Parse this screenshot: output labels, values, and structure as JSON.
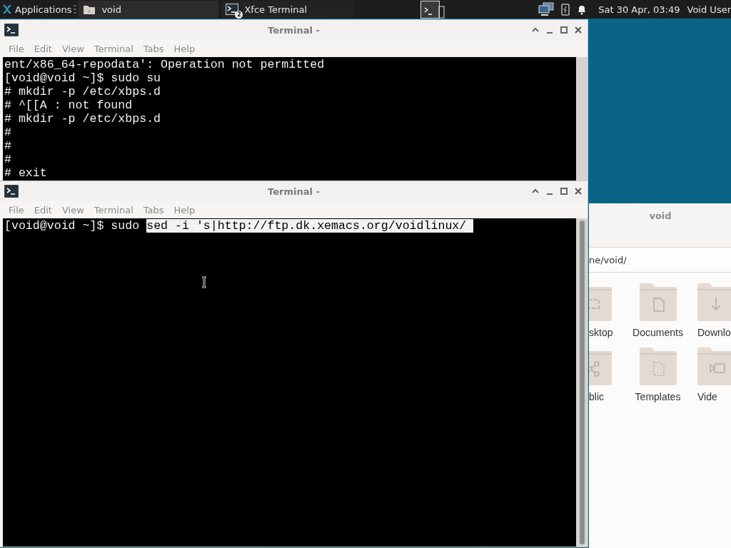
{
  "panel": {
    "apps_menu": "Applications",
    "tasks": [
      {
        "label": "void",
        "kind": "folder"
      },
      {
        "label": "Xfce Terminal",
        "kind": "terminal",
        "badge": "2"
      }
    ],
    "clock": "Sat 30 Apr, 03:49",
    "user": "Void User"
  },
  "file_manager": {
    "title": "void",
    "path": "ne/void/",
    "items": [
      {
        "label": "sktop",
        "kind": "desktop"
      },
      {
        "label": "Documents",
        "kind": "documents"
      },
      {
        "label": "Downlo",
        "kind": "downloads"
      },
      {
        "label": "blic",
        "kind": "public"
      },
      {
        "label": "Templates",
        "kind": "templates"
      },
      {
        "label": "Vide",
        "kind": "videos"
      }
    ]
  },
  "terminals": [
    {
      "title": "Terminal -",
      "menu": [
        "File",
        "Edit",
        "View",
        "Terminal",
        "Tabs",
        "Help"
      ],
      "lines": [
        [
          {
            "text": "ent/x86_64-repodata': Operation not permitted",
            "selected": false
          }
        ],
        [
          {
            "text": "[void@void ~]$ sudo su",
            "selected": false
          }
        ],
        [
          {
            "text": "# mkdir -p /etc/xbps.d",
            "selected": false
          }
        ],
        [
          {
            "text": "# ^[[A : not found",
            "selected": false
          }
        ],
        [
          {
            "text": "# mkdir -p /etc/xbps.d",
            "selected": false
          }
        ],
        [
          {
            "text": "#",
            "selected": false
          }
        ],
        [
          {
            "text": "#",
            "selected": false
          }
        ],
        [
          {
            "text": "#",
            "selected": false
          }
        ],
        [
          {
            "text": "# exit",
            "selected": false
          }
        ]
      ]
    },
    {
      "title": "Terminal -",
      "menu": [
        "File",
        "Edit",
        "View",
        "Terminal",
        "Tabs",
        "Help"
      ],
      "lines": [
        [
          {
            "text": "[void@void ~]$ sudo ",
            "selected": false
          },
          {
            "text": "sed -i 's|http://ftp.dk.xemacs.org/voidlinux/ ",
            "selected": true
          }
        ]
      ]
    }
  ]
}
